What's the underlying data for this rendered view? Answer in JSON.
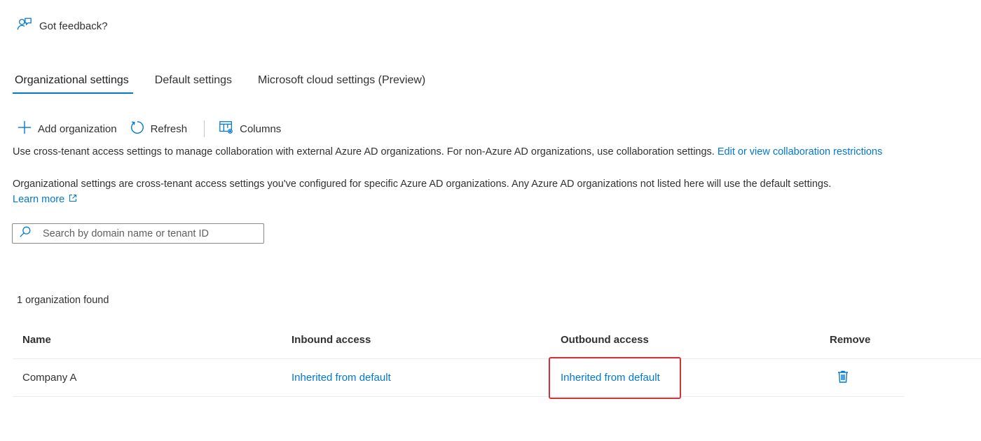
{
  "feedback": {
    "label": "Got feedback?",
    "icon": "feedback-icon"
  },
  "tabs": [
    {
      "label": "Organizational settings",
      "active": true
    },
    {
      "label": "Default settings",
      "active": false
    },
    {
      "label": "Microsoft cloud settings (Preview)",
      "active": false
    }
  ],
  "toolbar": {
    "add_label": "Add organization",
    "refresh_label": "Refresh",
    "columns_label": "Columns"
  },
  "description": {
    "line1": "Use cross-tenant access settings to manage collaboration with external Azure AD organizations. For non-Azure AD organizations, use collaboration settings.",
    "line1_link": "Edit or view collaboration restrictions",
    "line2": "Organizational settings are cross-tenant access settings you've configured for specific Azure AD organizations. Any Azure AD organizations not listed here will use the default settings.",
    "learn_more": "Learn more"
  },
  "search": {
    "placeholder": "Search by domain name or tenant ID",
    "value": ""
  },
  "results": {
    "count_text": "1 organization found"
  },
  "table": {
    "columns": [
      "Name",
      "Inbound access",
      "Outbound access",
      "Remove"
    ],
    "rows": [
      {
        "name": "Company A",
        "inbound": "Inherited from default",
        "outbound": "Inherited from default"
      }
    ]
  },
  "colors": {
    "accent": "#0078d4",
    "highlight": "#d13438"
  }
}
